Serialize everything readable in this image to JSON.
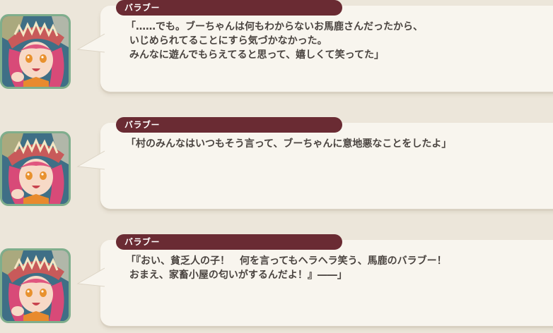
{
  "entries": [
    {
      "speaker": "バラブー",
      "text": "「……でも。ブーちゃんは何もわからないお馬鹿さんだったから、\n いじめられてることにすら気づかなかった。\n みんなに遊んでもらえてると思って、嬉しくて笑ってた」",
      "icon": "character-portrait-icon"
    },
    {
      "speaker": "バラブー",
      "text": "「村のみんなはいつもそう言って、ブーちゃんに意地悪なことをしたよ」",
      "icon": "character-portrait-icon"
    },
    {
      "speaker": "バラブー",
      "text": "「『おい、貧乏人の子！　何を言ってもヘラヘラ笑う、馬鹿のバラブー！\n おまえ、家畜小屋の匂いがするんだよ！』――」",
      "icon": "character-portrait-icon"
    }
  ],
  "colors": {
    "background": "#ece6da",
    "bubble": "#f8f5ee",
    "name_tag": "#6a2b33",
    "text": "#4a4440",
    "portrait_border": "#7fae8c"
  }
}
